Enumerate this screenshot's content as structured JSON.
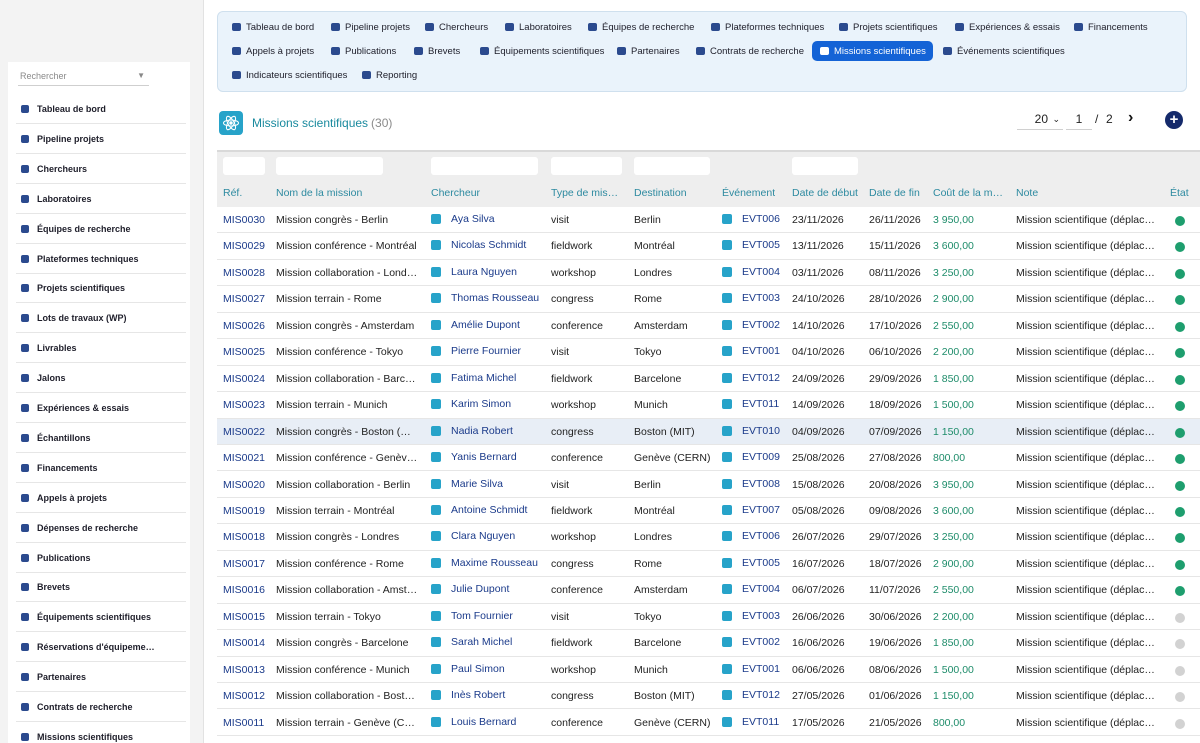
{
  "sidebar": {
    "search_placeholder": "Rechercher",
    "items": [
      {
        "label": "Tableau de bord",
        "icon": "dashboard-icon"
      },
      {
        "label": "Pipeline projets",
        "icon": "list-icon"
      },
      {
        "label": "Chercheurs",
        "icon": "researcher-icon"
      },
      {
        "label": "Laboratoires",
        "icon": "flask-icon"
      },
      {
        "label": "Équipes de recherche",
        "icon": "team-icon"
      },
      {
        "label": "Plateformes techniques",
        "icon": "platform-icon"
      },
      {
        "label": "Projets scientifiques",
        "icon": "project-icon"
      },
      {
        "label": "Lots de travaux (WP)",
        "icon": "tasks-icon"
      },
      {
        "label": "Livrables",
        "icon": "deliverable-icon"
      },
      {
        "label": "Jalons",
        "icon": "flag-icon"
      },
      {
        "label": "Expériences & essais",
        "icon": "experiment-icon"
      },
      {
        "label": "Échantillons",
        "icon": "sample-icon"
      },
      {
        "label": "Financements",
        "icon": "money-icon"
      },
      {
        "label": "Appels à projets",
        "icon": "megaphone-icon"
      },
      {
        "label": "Dépenses de recherche",
        "icon": "receipt-icon"
      },
      {
        "label": "Publications",
        "icon": "book-icon"
      },
      {
        "label": "Brevets",
        "icon": "patent-icon"
      },
      {
        "label": "Équipements scientifiques",
        "icon": "microscope-icon"
      },
      {
        "label": "Réservations d'équipeme…",
        "icon": "calendar-icon"
      },
      {
        "label": "Partenaires",
        "icon": "building-icon"
      },
      {
        "label": "Contrats de recherche",
        "icon": "contract-icon"
      },
      {
        "label": "Missions scientifiques",
        "icon": "plane-icon"
      }
    ]
  },
  "topnav": {
    "items": [
      {
        "label": "Tableau de bord"
      },
      {
        "label": "Pipeline projets"
      },
      {
        "label": "Chercheurs"
      },
      {
        "label": "Laboratoires"
      },
      {
        "label": "Équipes de recherche"
      },
      {
        "label": "Plateformes techniques"
      },
      {
        "label": "Projets scientifiques"
      },
      {
        "label": "Expériences & essais"
      },
      {
        "label": "Financements"
      },
      {
        "label": "Appels à projets"
      },
      {
        "label": "Publications"
      },
      {
        "label": "Brevets"
      },
      {
        "label": "Équipements scientifiques"
      },
      {
        "label": "Partenaires"
      },
      {
        "label": "Contrats de recherche"
      },
      {
        "label": "Missions scientifiques"
      },
      {
        "label": "Événements scientifiques"
      },
      {
        "label": "Indicateurs scientifiques"
      },
      {
        "label": "Reporting"
      }
    ],
    "active": "Missions scientifiques"
  },
  "header": {
    "title": "Missions scientifiques",
    "count": "(30)",
    "per_page": "20",
    "page_current": "1",
    "page_sep": "/",
    "page_total": "2"
  },
  "table": {
    "columns": [
      "Réf.",
      "Nom de la mission",
      "Chercheur",
      "Type de mis…",
      "Destination",
      "Événement",
      "Date de début",
      "Date de fin",
      "Coût de la m…",
      "Note",
      "État"
    ],
    "rows": [
      {
        "ref": "MIS0030",
        "name": "Mission congrès - Berlin",
        "researcher": "Aya Silva",
        "type": "visit",
        "dest": "Berlin",
        "event": "EVT006",
        "start": "23/11/2026",
        "end": "26/11/2026",
        "cost": "3 950,00",
        "note": "Mission scientifique (déplac…",
        "status": "green"
      },
      {
        "ref": "MIS0029",
        "name": "Mission conférence - Montréal",
        "researcher": "Nicolas Schmidt",
        "type": "fieldwork",
        "dest": "Montréal",
        "event": "EVT005",
        "start": "13/11/2026",
        "end": "15/11/2026",
        "cost": "3 600,00",
        "note": "Mission scientifique (déplac…",
        "status": "green"
      },
      {
        "ref": "MIS0028",
        "name": "Mission collaboration - Lond…",
        "researcher": "Laura Nguyen",
        "type": "workshop",
        "dest": "Londres",
        "event": "EVT004",
        "start": "03/11/2026",
        "end": "08/11/2026",
        "cost": "3 250,00",
        "note": "Mission scientifique (déplac…",
        "status": "green"
      },
      {
        "ref": "MIS0027",
        "name": "Mission terrain - Rome",
        "researcher": "Thomas Rousseau",
        "type": "congress",
        "dest": "Rome",
        "event": "EVT003",
        "start": "24/10/2026",
        "end": "28/10/2026",
        "cost": "2 900,00",
        "note": "Mission scientifique (déplac…",
        "status": "green"
      },
      {
        "ref": "MIS0026",
        "name": "Mission congrès - Amsterdam",
        "researcher": "Amélie Dupont",
        "type": "conference",
        "dest": "Amsterdam",
        "event": "EVT002",
        "start": "14/10/2026",
        "end": "17/10/2026",
        "cost": "2 550,00",
        "note": "Mission scientifique (déplac…",
        "status": "green"
      },
      {
        "ref": "MIS0025",
        "name": "Mission conférence - Tokyo",
        "researcher": "Pierre Fournier",
        "type": "visit",
        "dest": "Tokyo",
        "event": "EVT001",
        "start": "04/10/2026",
        "end": "06/10/2026",
        "cost": "2 200,00",
        "note": "Mission scientifique (déplac…",
        "status": "green"
      },
      {
        "ref": "MIS0024",
        "name": "Mission collaboration - Barc…",
        "researcher": "Fatima Michel",
        "type": "fieldwork",
        "dest": "Barcelone",
        "event": "EVT012",
        "start": "24/09/2026",
        "end": "29/09/2026",
        "cost": "1 850,00",
        "note": "Mission scientifique (déplac…",
        "status": "green"
      },
      {
        "ref": "MIS0023",
        "name": "Mission terrain - Munich",
        "researcher": "Karim Simon",
        "type": "workshop",
        "dest": "Munich",
        "event": "EVT011",
        "start": "14/09/2026",
        "end": "18/09/2026",
        "cost": "1 500,00",
        "note": "Mission scientifique (déplac…",
        "status": "green"
      },
      {
        "ref": "MIS0022",
        "name": "Mission congrès - Boston (…",
        "researcher": "Nadia Robert",
        "type": "congress",
        "dest": "Boston (MIT)",
        "event": "EVT010",
        "start": "04/09/2026",
        "end": "07/09/2026",
        "cost": "1 150,00",
        "note": "Mission scientifique (déplac…",
        "status": "green",
        "highlight": true
      },
      {
        "ref": "MIS0021",
        "name": "Mission conférence - Genèv…",
        "researcher": "Yanis Bernard",
        "type": "conference",
        "dest": "Genève (CERN)",
        "event": "EVT009",
        "start": "25/08/2026",
        "end": "27/08/2026",
        "cost": "800,00",
        "note": "Mission scientifique (déplac…",
        "status": "green"
      },
      {
        "ref": "MIS0020",
        "name": "Mission collaboration - Berlin",
        "researcher": "Marie Silva",
        "type": "visit",
        "dest": "Berlin",
        "event": "EVT008",
        "start": "15/08/2026",
        "end": "20/08/2026",
        "cost": "3 950,00",
        "note": "Mission scientifique (déplac…",
        "status": "green"
      },
      {
        "ref": "MIS0019",
        "name": "Mission terrain - Montréal",
        "researcher": "Antoine Schmidt",
        "type": "fieldwork",
        "dest": "Montréal",
        "event": "EVT007",
        "start": "05/08/2026",
        "end": "09/08/2026",
        "cost": "3 600,00",
        "note": "Mission scientifique (déplac…",
        "status": "green"
      },
      {
        "ref": "MIS0018",
        "name": "Mission congrès - Londres",
        "researcher": "Clara Nguyen",
        "type": "workshop",
        "dest": "Londres",
        "event": "EVT006",
        "start": "26/07/2026",
        "end": "29/07/2026",
        "cost": "3 250,00",
        "note": "Mission scientifique (déplac…",
        "status": "green"
      },
      {
        "ref": "MIS0017",
        "name": "Mission conférence - Rome",
        "researcher": "Maxime Rousseau",
        "type": "congress",
        "dest": "Rome",
        "event": "EVT005",
        "start": "16/07/2026",
        "end": "18/07/2026",
        "cost": "2 900,00",
        "note": "Mission scientifique (déplac…",
        "status": "green"
      },
      {
        "ref": "MIS0016",
        "name": "Mission collaboration - Amst…",
        "researcher": "Julie Dupont",
        "type": "conference",
        "dest": "Amsterdam",
        "event": "EVT004",
        "start": "06/07/2026",
        "end": "11/07/2026",
        "cost": "2 550,00",
        "note": "Mission scientifique (déplac…",
        "status": "green"
      },
      {
        "ref": "MIS0015",
        "name": "Mission terrain - Tokyo",
        "researcher": "Tom Fournier",
        "type": "visit",
        "dest": "Tokyo",
        "event": "EVT003",
        "start": "26/06/2026",
        "end": "30/06/2026",
        "cost": "2 200,00",
        "note": "Mission scientifique (déplac…",
        "status": "grey"
      },
      {
        "ref": "MIS0014",
        "name": "Mission congrès - Barcelone",
        "researcher": "Sarah Michel",
        "type": "fieldwork",
        "dest": "Barcelone",
        "event": "EVT002",
        "start": "16/06/2026",
        "end": "19/06/2026",
        "cost": "1 850,00",
        "note": "Mission scientifique (déplac…",
        "status": "grey"
      },
      {
        "ref": "MIS0013",
        "name": "Mission conférence - Munich",
        "researcher": "Paul Simon",
        "type": "workshop",
        "dest": "Munich",
        "event": "EVT001",
        "start": "06/06/2026",
        "end": "08/06/2026",
        "cost": "1 500,00",
        "note": "Mission scientifique (déplac…",
        "status": "grey"
      },
      {
        "ref": "MIS0012",
        "name": "Mission collaboration - Bost…",
        "researcher": "Inès Robert",
        "type": "congress",
        "dest": "Boston (MIT)",
        "event": "EVT012",
        "start": "27/05/2026",
        "end": "01/06/2026",
        "cost": "1 150,00",
        "note": "Mission scientifique (déplac…",
        "status": "grey"
      },
      {
        "ref": "MIS0011",
        "name": "Mission terrain - Genève (C…",
        "researcher": "Louis Bernard",
        "type": "conference",
        "dest": "Genève (CERN)",
        "event": "EVT011",
        "start": "17/05/2026",
        "end": "21/05/2026",
        "cost": "800,00",
        "note": "Mission scientifique (déplac…",
        "status": "grey"
      }
    ]
  },
  "colors": {
    "accent": "#1463d6",
    "title": "#1a8a9e",
    "link": "#1a3a8a",
    "cost": "#1e8c6a",
    "status_green": "#1e9e6e",
    "status_grey": "#d2d2d2"
  }
}
